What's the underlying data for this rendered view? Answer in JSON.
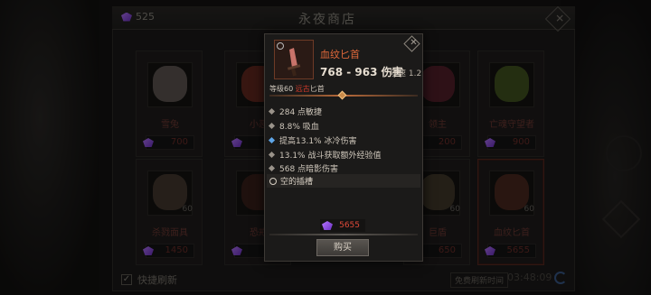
{
  "shop": {
    "currency": "525",
    "title": "永夜商店",
    "auto_refresh": "快捷刷新",
    "free_refresh": "免费刷新时间",
    "timer": "03:48:09",
    "items": [
      {
        "name": "雪兔",
        "price": "700",
        "count": ""
      },
      {
        "name": "小恶",
        "price": "12",
        "count": ""
      },
      {
        "name": "",
        "price": "",
        "count": ""
      },
      {
        "name": "领主",
        "price": "200",
        "count": ""
      },
      {
        "name": "亡魂守望者",
        "price": "900",
        "count": ""
      },
      {
        "name": "杀戮面具",
        "price": "1450",
        "count": "60"
      },
      {
        "name": "恐戒",
        "price": "17",
        "count": ""
      },
      {
        "name": "",
        "price": "",
        "count": ""
      },
      {
        "name": "巨盾",
        "price": "650",
        "count": "60"
      },
      {
        "name": "血纹匕首",
        "price": "5655",
        "count": "60"
      }
    ]
  },
  "tooltip": {
    "name": "血纹匕首",
    "damage": "768 - 963 伤害",
    "speed": "攻速 1.2",
    "level_prefix": "等级60 ",
    "rarity": "远古",
    "type": "匕首",
    "stats": [
      {
        "text": "284 点敏捷",
        "kind": "normal"
      },
      {
        "text": "8.8% 吸血",
        "kind": "normal"
      },
      {
        "text": "提高13.1% 冰冷伤害",
        "kind": "blue"
      },
      {
        "text": "13.1% 战斗获取额外经验值",
        "kind": "normal"
      },
      {
        "text": "568 点暗影伤害",
        "kind": "normal"
      }
    ],
    "socket": "空的插槽",
    "price": "5655",
    "buy": "购买"
  },
  "colors": {
    "accent": "#e0683a",
    "price": "#e04a3a",
    "gem": "#8b4de0",
    "rarity": "#d23a2a"
  },
  "icons": [
    "gem-icon",
    "close-icon",
    "dagger-icon",
    "checkbox-icon",
    "refresh-icon",
    "socket-icon"
  ]
}
